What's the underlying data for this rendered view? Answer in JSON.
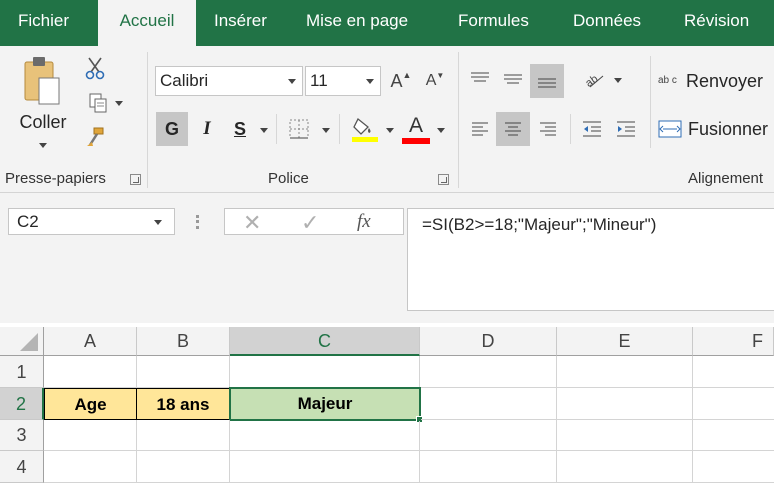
{
  "tabs": [
    {
      "label": "Fichier",
      "active": false
    },
    {
      "label": "Accueil",
      "active": true
    },
    {
      "label": "Insérer",
      "active": false
    },
    {
      "label": "Mise en page",
      "active": false
    },
    {
      "label": "Formules",
      "active": false
    },
    {
      "label": "Données",
      "active": false
    },
    {
      "label": "Révision",
      "active": false
    }
  ],
  "clipboard": {
    "paste_label": "Coller",
    "group_label": "Presse-papiers"
  },
  "font": {
    "name": "Calibri",
    "size": "11",
    "grow_label": "A",
    "shrink_label": "A",
    "bold_label": "G",
    "italic_label": "I",
    "underline_label": "S",
    "font_color_label": "A",
    "highlight_color": "#ffff00",
    "font_color": "#ff0000",
    "group_label": "Police"
  },
  "alignment": {
    "wrap_label": "Renvoyer",
    "merge_label": "Fusionner",
    "group_label": "Alignement",
    "wrap_icon_text": "ab c"
  },
  "formula_bar": {
    "name_box": "C2",
    "fx_label": "fx",
    "formula": "=SI(B2>=18;\"Majeur\";\"Mineur\")"
  },
  "sheet": {
    "columns": [
      "A",
      "B",
      "C",
      "D",
      "E",
      "F"
    ],
    "rows": [
      "1",
      "2",
      "3",
      "4"
    ],
    "selected_cell": "C2",
    "cells": {
      "A2": "Age",
      "B2": "18 ans",
      "C2": "Majeur"
    },
    "fills": {
      "A2": "#ffe699",
      "B2": "#ffe699",
      "C2": "#c6e0b4"
    }
  },
  "colors": {
    "brand": "#217346",
    "ribbon_bg": "#f3f3f3"
  }
}
